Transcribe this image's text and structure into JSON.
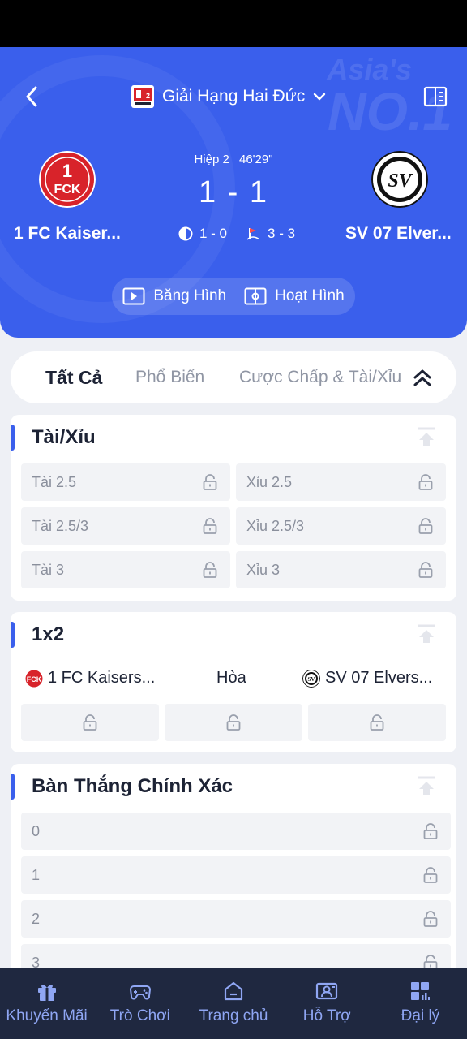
{
  "header": {
    "league_name": "Giải Hạng Hai Đức",
    "watermark_line1": "Asia's",
    "watermark_line2": "NO.1"
  },
  "match": {
    "home_team": "1 FC Kaiser...",
    "away_team": "SV 07 Elver...",
    "period": "Hiệp 2",
    "clock": "46'29\"",
    "score": "1 - 1",
    "halftime_score": "1 - 0",
    "corners": "3 - 3"
  },
  "media": {
    "video_label": "Băng Hình",
    "animation_label": "Hoạt Hình"
  },
  "tabs": [
    {
      "label": "Tất Cả",
      "active": true
    },
    {
      "label": "Phổ Biến",
      "active": false
    },
    {
      "label": "Cược Chấp & Tài/Xỉu",
      "active": false
    }
  ],
  "over_under": {
    "title": "Tài/Xỉu",
    "rows": [
      [
        "Tài 2.5",
        "Xỉu 2.5"
      ],
      [
        "Tài 2.5/3",
        "Xỉu 2.5/3"
      ],
      [
        "Tài 3",
        "Xỉu 3"
      ]
    ]
  },
  "one_x_two": {
    "title": "1x2",
    "home_label": "1 FC Kaisers...",
    "draw_label": "Hòa",
    "away_label": "SV 07 Elvers..."
  },
  "correct_score": {
    "title": "Bàn Thắng Chính Xác",
    "rows": [
      "0",
      "1",
      "2",
      "3"
    ]
  },
  "bottom_nav": [
    {
      "label": "Khuyến Mãi",
      "icon": "gift-icon"
    },
    {
      "label": "Trò Chơi",
      "icon": "gamepad-icon"
    },
    {
      "label": "Trang chủ",
      "icon": "home-icon"
    },
    {
      "label": "Hỗ Trợ",
      "icon": "support-icon"
    },
    {
      "label": "Đại lý",
      "icon": "agent-icon"
    }
  ],
  "colors": {
    "primary": "#3a5fec",
    "nav_bg": "#1f2840",
    "nav_text": "#8fa6f3",
    "home_red": "#d8232a"
  }
}
